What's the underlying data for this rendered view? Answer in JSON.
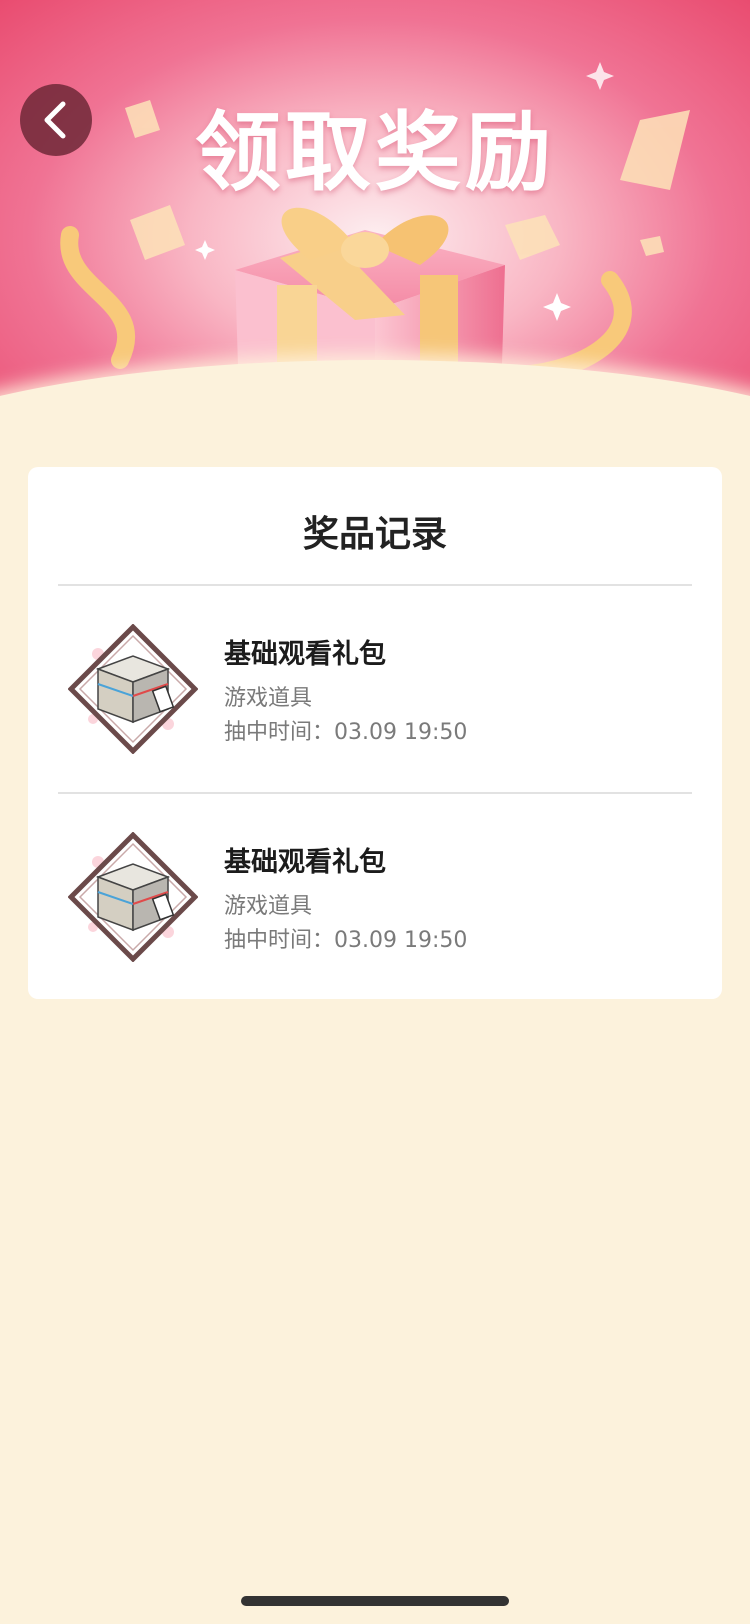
{
  "header": {
    "title": "领取奖励"
  },
  "records_card": {
    "title": "奖品记录",
    "items": [
      {
        "name": "基础观看礼包",
        "type": "游戏道具",
        "time_label": "抽中时间：",
        "time_value": "03.09 19:50"
      },
      {
        "name": "基础观看礼包",
        "type": "游戏道具",
        "time_label": "抽中时间：",
        "time_value": "03.09 19:50"
      }
    ]
  },
  "colors": {
    "hero_pink": "#e94c70",
    "background_cream": "#fcf2dc",
    "ribbon_gold": "#f8c97a"
  }
}
